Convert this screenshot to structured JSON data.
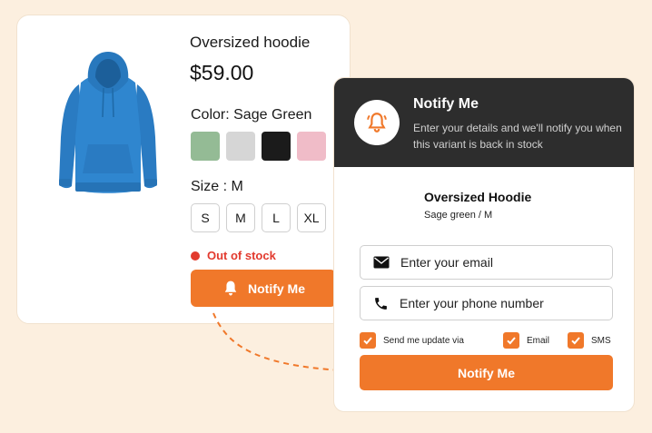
{
  "colors": {
    "background": "#fcefdf",
    "accent": "#f0782a",
    "header": "#2d2d2d",
    "out_of_stock": "#e23a2e",
    "hoodie": "#2f86cf"
  },
  "product": {
    "image_alt": "blue-hoodie-image",
    "title": "Oversized hoodie",
    "price": "$59.00",
    "color_label": "Color: Sage Green",
    "swatches": [
      {
        "name": "sage-green",
        "hex": "#94bb95"
      },
      {
        "name": "light-gray",
        "hex": "#d6d6d6"
      },
      {
        "name": "black",
        "hex": "#1b1b1b"
      },
      {
        "name": "pink",
        "hex": "#f0bcc8"
      }
    ],
    "size_label": "Size : M",
    "sizes": [
      "S",
      "M",
      "L",
      "XL"
    ],
    "stock_status": "Out of stock",
    "notify_button": "Notify Me",
    "notify_icon": "bell-icon"
  },
  "modal": {
    "icon": "bell-icon",
    "title": "Notify Me",
    "subtitle": "Enter your details and we'll notify you when this variant is back in stock",
    "product_name": "Oversized Hoodie",
    "variant": "Sage green / M",
    "email_placeholder": "Enter your email",
    "email_icon": "envelope-icon",
    "phone_placeholder": "Enter your phone number",
    "phone_icon": "phone-icon",
    "preferences": {
      "label": "Send me update via",
      "email_label": "Email",
      "sms_label": "SMS",
      "via_checked": true,
      "email_checked": true,
      "sms_checked": true
    },
    "submit_button": "Notify Me"
  }
}
